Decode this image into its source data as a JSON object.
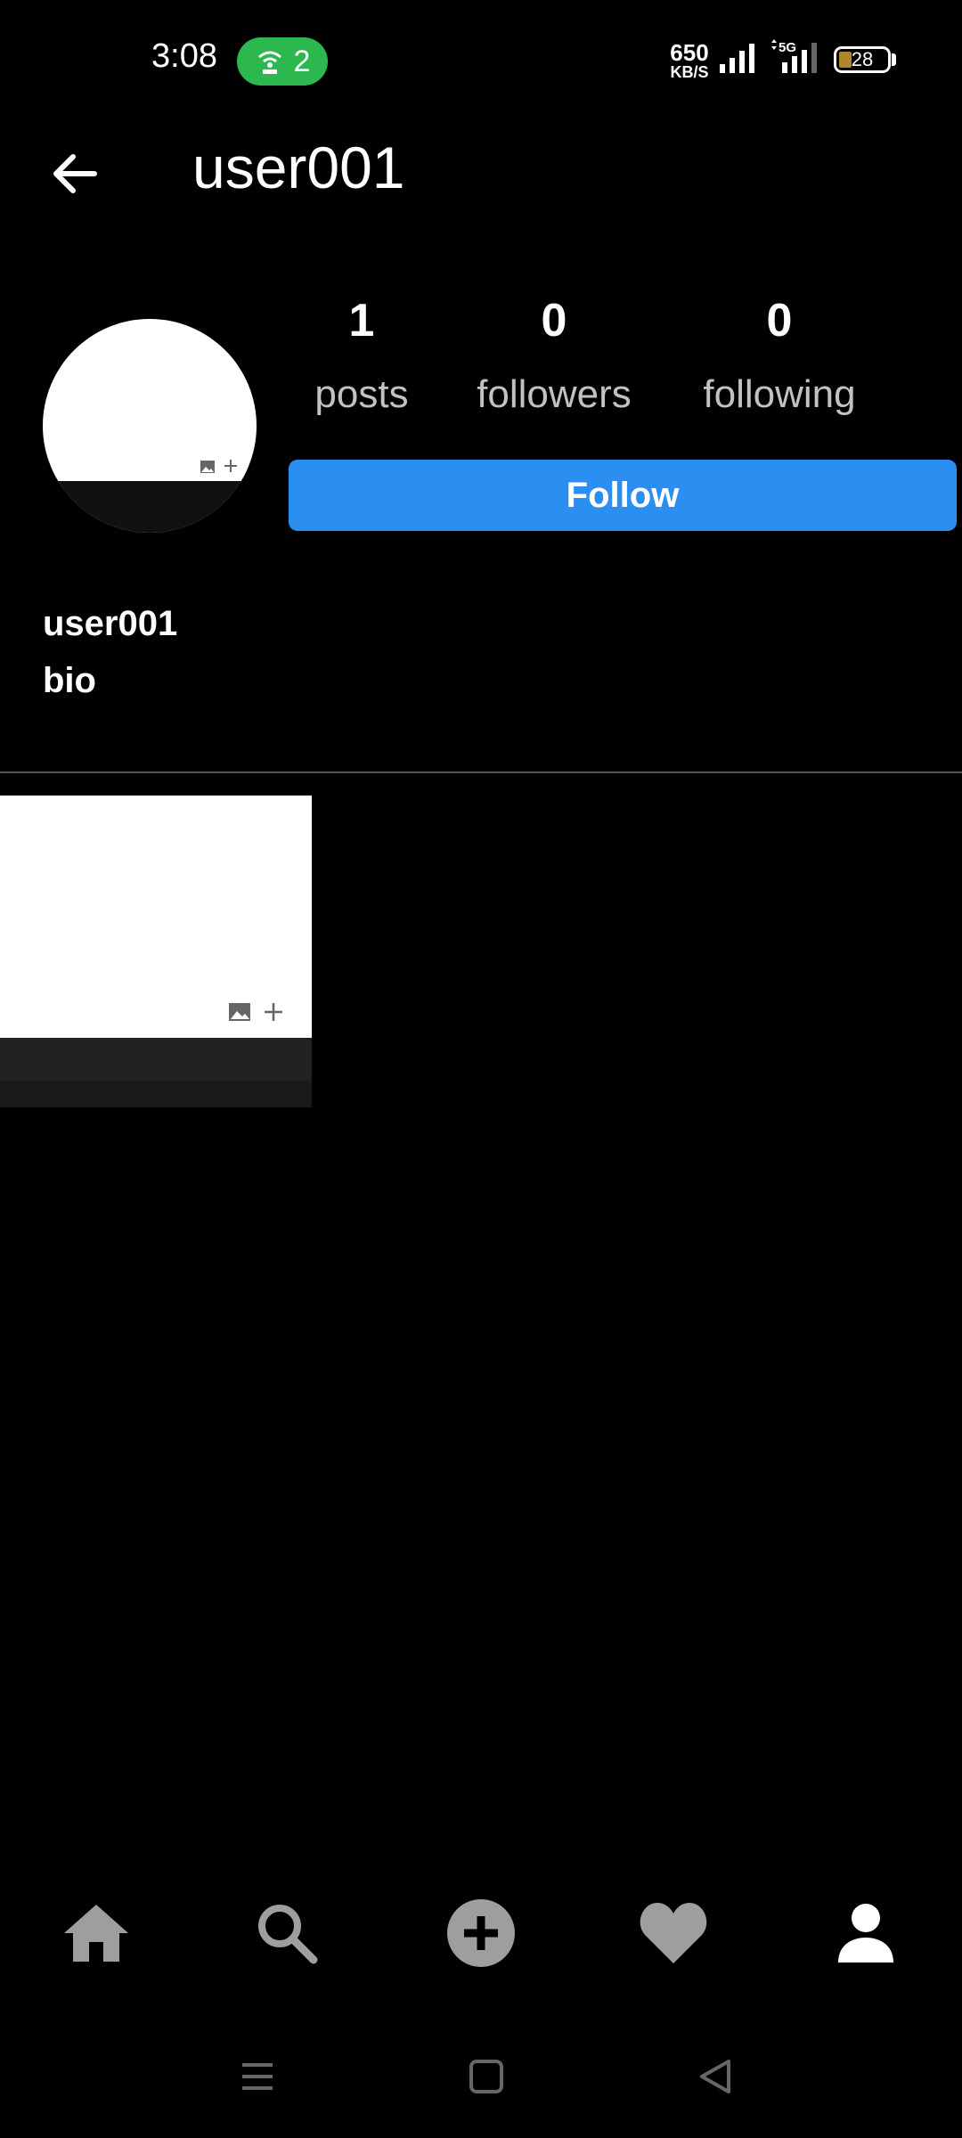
{
  "status_bar": {
    "time": "3:08",
    "hotspot_count": "2",
    "speed_value": "650",
    "speed_unit": "KB/S",
    "network_label": "5G",
    "battery": "28"
  },
  "header": {
    "title": "user001",
    "back_icon": "arrow-left-icon"
  },
  "profile": {
    "stats": [
      {
        "value": "1",
        "label": "posts"
      },
      {
        "value": "0",
        "label": "followers"
      },
      {
        "value": "0",
        "label": "following"
      }
    ],
    "follow_label": "Follow",
    "username": "user001",
    "bio": "bio"
  },
  "bottom_nav": {
    "items": [
      "home-icon",
      "search-icon",
      "add-post-icon",
      "heart-icon",
      "profile-icon"
    ]
  },
  "system_nav": {
    "items": [
      "menu-icon",
      "home-square-icon",
      "back-triangle-icon"
    ]
  },
  "colors": {
    "accent": "#2a8ff0",
    "hotspot": "#2db84f",
    "inactive_icon": "#9e9e9e",
    "active_icon": "#ffffff"
  }
}
